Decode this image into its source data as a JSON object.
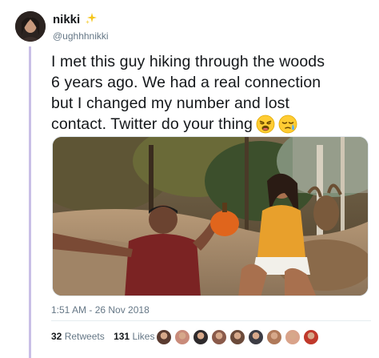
{
  "author": {
    "display_name": "nikki",
    "username": "@ughhhnikki",
    "avatar_icon": "user-avatar",
    "badge_icon": "sparkle-icon"
  },
  "tweet": {
    "text_lines": [
      "I met this guy hiking through the woods",
      "6 years ago. We had a real connection",
      "but I changed my number and lost",
      "contact. Twitter do your thing"
    ],
    "emojis": [
      "weary-face-emoji",
      "sleepy-face-emoji"
    ],
    "timestamp": "1:51 AM - 26 Nov 2018"
  },
  "stats": {
    "retweets_count": "32",
    "retweets_label": "Retweets",
    "likes_count": "131",
    "likes_label": "Likes"
  },
  "likers": [
    {
      "name": "liker-avatar-1",
      "color": "#5a3b30"
    },
    {
      "name": "liker-avatar-2",
      "color": "#c98b7a"
    },
    {
      "name": "liker-avatar-3",
      "color": "#2e2a2c"
    },
    {
      "name": "liker-avatar-4",
      "color": "#8a5a4a"
    },
    {
      "name": "liker-avatar-5",
      "color": "#6b4a3a"
    },
    {
      "name": "liker-avatar-6",
      "color": "#3c3c44"
    },
    {
      "name": "liker-avatar-7",
      "color": "#b07a5a"
    },
    {
      "name": "liker-avatar-8",
      "color": "#d9a38a"
    },
    {
      "name": "liker-avatar-9",
      "color": "#c0392b"
    }
  ],
  "colors": {
    "thread_line": "#c9bfe6",
    "secondary_text": "#657786",
    "primary_text": "#14171a"
  }
}
